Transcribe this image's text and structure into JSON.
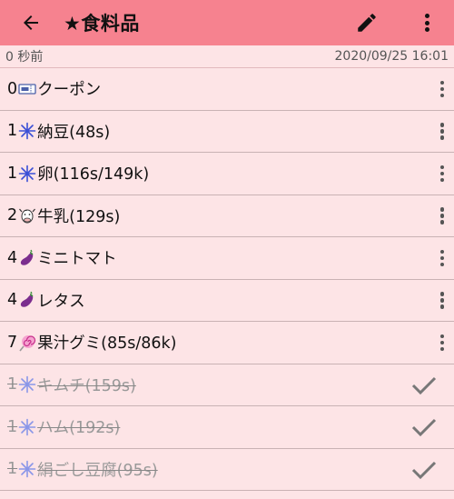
{
  "appbar": {
    "title": "★食料品"
  },
  "status": {
    "left": "0 秒前",
    "right": "2020/09/25 16:01"
  },
  "items": [
    {
      "count": "0",
      "icon": "coupon-icon",
      "label": "クーポン",
      "done": false
    },
    {
      "count": "1",
      "icon": "snowflake-icon",
      "label": "納豆(48s)",
      "done": false
    },
    {
      "count": "1",
      "icon": "snowflake-icon",
      "label": "卵(116s/149k)",
      "done": false
    },
    {
      "count": "2",
      "icon": "cow-icon",
      "label": "牛乳(129s)",
      "done": false
    },
    {
      "count": "4",
      "icon": "eggplant-icon",
      "label": "ミニトマト",
      "done": false
    },
    {
      "count": "4",
      "icon": "eggplant-icon",
      "label": "レタス",
      "done": false
    },
    {
      "count": "7",
      "icon": "lollipop-icon",
      "label": "果汁グミ(85s/86k)",
      "done": false
    },
    {
      "count": "1",
      "icon": "snowflake-icon",
      "label": "キムチ(159s)",
      "done": true
    },
    {
      "count": "1",
      "icon": "snowflake-icon",
      "label": "ハム(192s)",
      "done": true
    },
    {
      "count": "1",
      "icon": "snowflake-icon",
      "label": "絹ごし豆腐(95s)",
      "done": true
    }
  ],
  "colors": {
    "appbar": "#f6828f",
    "background": "#fde4e6",
    "snowflake": "#3a4fd6",
    "snowflake_done": "#8a96e8"
  }
}
